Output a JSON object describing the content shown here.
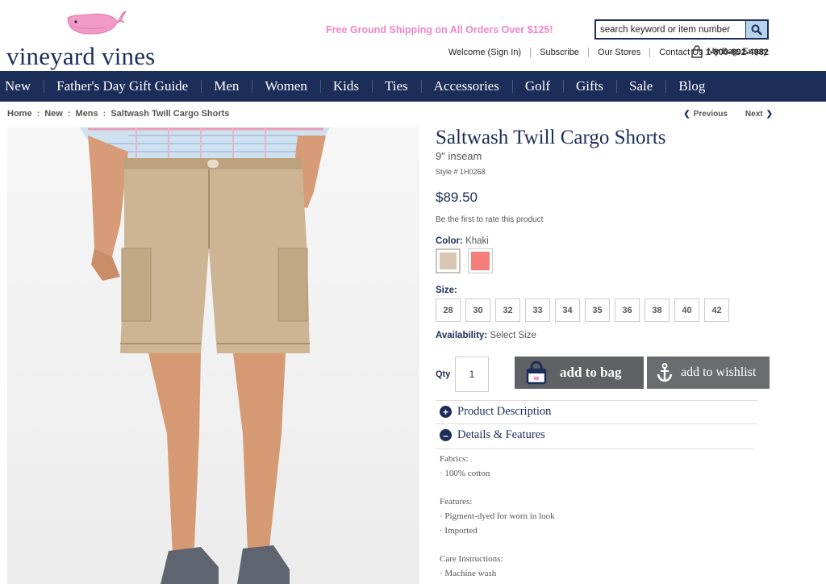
{
  "brand": {
    "name": "vineyard vines",
    "logo_icon": "whale-icon",
    "accent": "#1c2d5a",
    "whale_color": "#f29ac6"
  },
  "promo": {
    "text": "Free Ground Shipping on All Orders Over $125!"
  },
  "search": {
    "placeholder": "search keyword or item number",
    "icon": "search-icon"
  },
  "utility": {
    "welcome": "Welcome (Sign In)",
    "subscribe": "Subscribe",
    "stores": "Our Stores",
    "contact_label": "Contact Us",
    "phone": "1-800-892-4982",
    "bag_label": "My Bag:",
    "bag_status": "Empty"
  },
  "nav": {
    "items": [
      "New",
      "Father's Day Gift Guide",
      "Men",
      "Women",
      "Kids",
      "Ties",
      "Accessories",
      "Golf",
      "Gifts",
      "Sale",
      "Blog"
    ]
  },
  "breadcrumb": {
    "items": [
      "Home",
      "New",
      "Mens",
      "Saltwash Twill Cargo Shorts"
    ],
    "separator": ":"
  },
  "pager": {
    "previous": "Previous",
    "next": "Next"
  },
  "product": {
    "title": "Saltwash Twill Cargo Shorts",
    "subtitle": "9\" inseam",
    "style": "Style # 1H0268",
    "price": "$89.50",
    "rating_prompt": "Be the first to rate this product",
    "color_label": "Color:",
    "color_value": "Khaki",
    "swatches": [
      {
        "name": "Khaki",
        "hex": "#d8c7b2",
        "selected": true
      },
      {
        "name": "Coral",
        "hex": "#f47e7a",
        "selected": false
      }
    ],
    "size_label": "Size:",
    "sizes": [
      "28",
      "30",
      "32",
      "33",
      "34",
      "35",
      "36",
      "38",
      "40",
      "42"
    ],
    "availability_label": "Availability:",
    "availability_value": "Select Size",
    "qty_label": "Qty",
    "qty_value": "1",
    "add_to_bag": "add to bag",
    "add_to_wishlist": "add to wishlist",
    "description_label": "Product Description",
    "details_label": "Details & Features",
    "details": {
      "fabrics_label": "Fabrics:",
      "fabrics": [
        "· 100% cotton"
      ],
      "features_label": "Features:",
      "features": [
        "· Pigment-dyed for worn in look",
        "· Imported"
      ],
      "care_label": "Care Instructions:",
      "care": [
        "· Machine wash"
      ]
    }
  }
}
